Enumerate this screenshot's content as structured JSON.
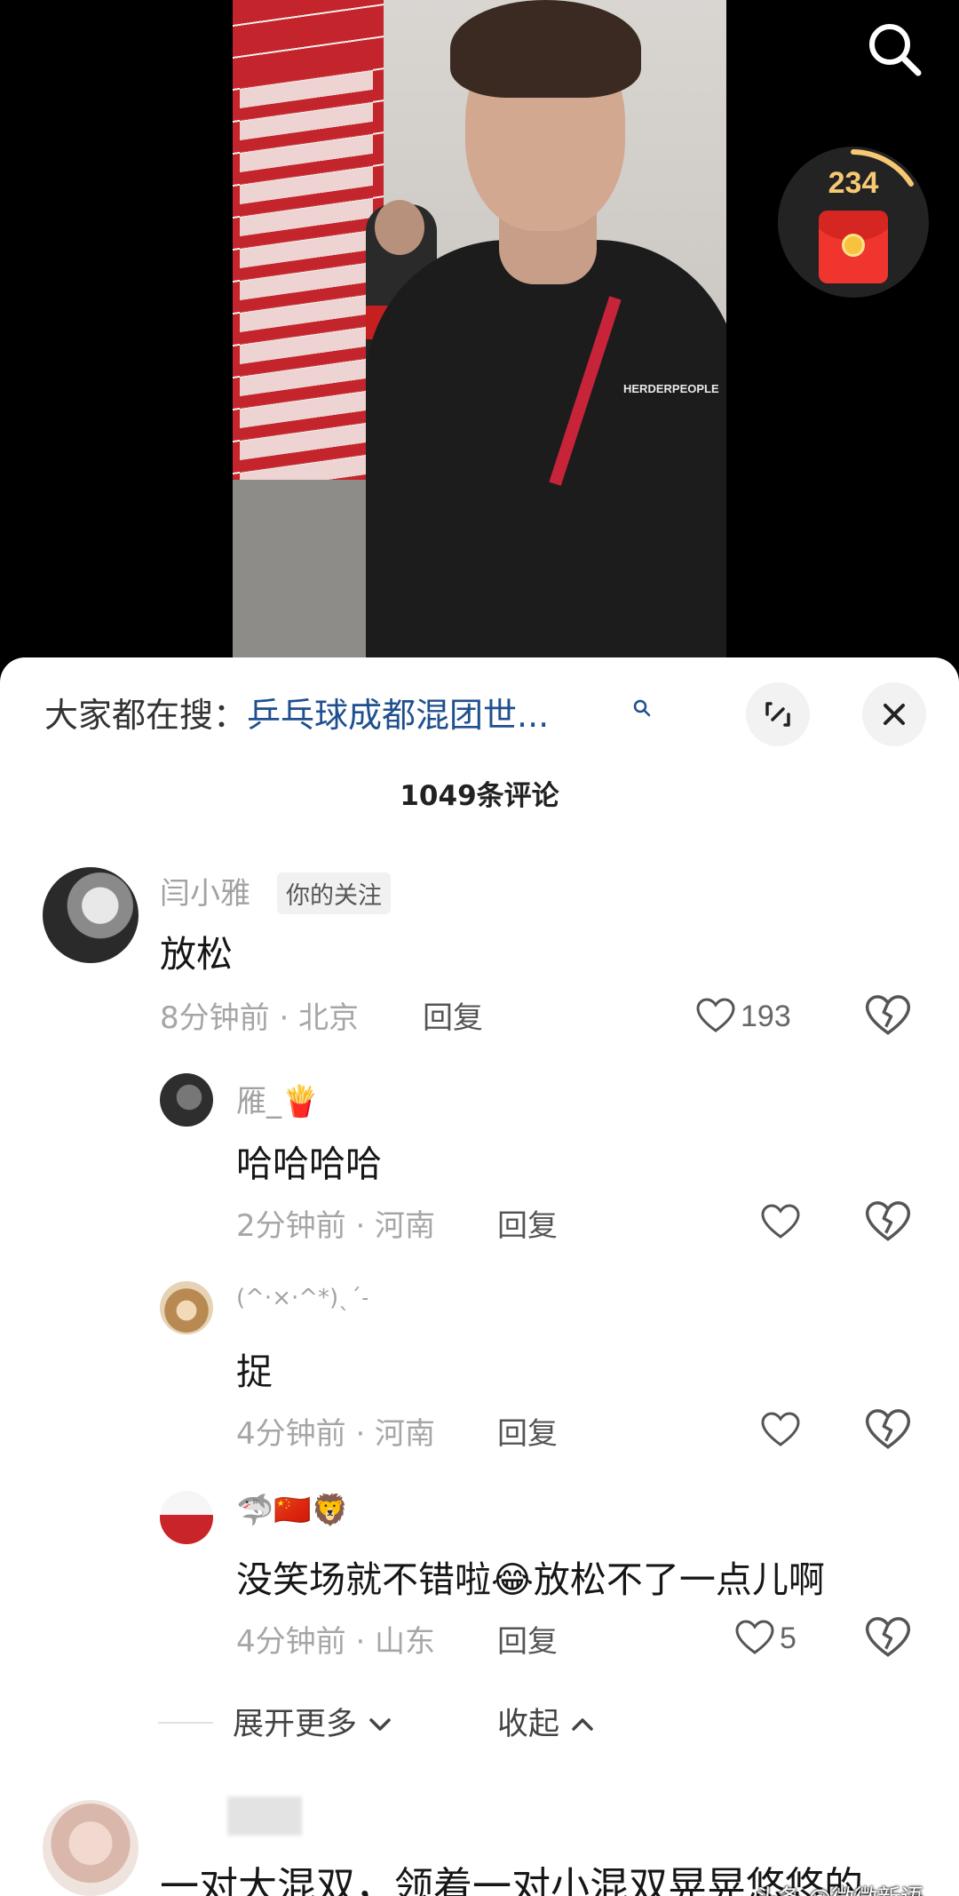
{
  "video": {
    "brand_logo": "HERDERPEOPLE"
  },
  "redpacket": {
    "count": "234"
  },
  "sheet": {
    "hot_search_prefix": "大家都在搜：",
    "hot_search_link": "乒乓球成都混团世...",
    "comment_count": "1049条评论"
  },
  "comments": [
    {
      "user": "闫小雅",
      "tag": "你的关注",
      "text": "放松",
      "meta": "8分钟前 · 北京",
      "reply": "回复",
      "likes": "193"
    },
    {
      "user": "雁_🍟",
      "text": "哈哈哈哈",
      "meta": "2分钟前 · 河南",
      "reply": "回复",
      "likes": ""
    },
    {
      "user": "(^·×·^*)ˎˊ˗",
      "text": "捉",
      "meta": "4分钟前 · 河南",
      "reply": "回复",
      "likes": ""
    },
    {
      "user": "🦈🇨🇳🦁",
      "text": "没笑场就不错啦😂放松不了一点儿啊",
      "meta": "4分钟前 · 山东",
      "reply": "回复",
      "likes": "5"
    }
  ],
  "expand": {
    "more": "展开更多",
    "collapse": "收起"
  },
  "next_comment": {
    "text": "一对大混双，领着一对小混双晃晃悠悠的"
  },
  "watermark": "头条 @微微新语",
  "colors": {
    "link": "#1f4f8f",
    "gold": "#f7c873",
    "red": "#f0352f"
  }
}
